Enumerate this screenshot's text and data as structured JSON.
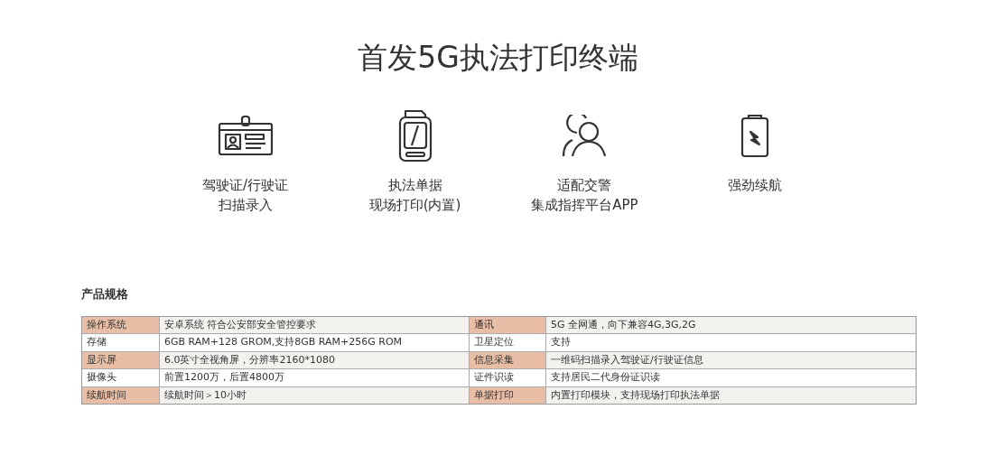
{
  "title": "首发5G执法打印终端",
  "features": [
    {
      "kind": "id-card",
      "lines": [
        "驾驶证/行驶证",
        "扫描录入"
      ]
    },
    {
      "kind": "printer",
      "lines": [
        "执法单据",
        "现场打印(内置)"
      ]
    },
    {
      "kind": "users",
      "lines": [
        "适配交警",
        "集成指挥平台APP"
      ]
    },
    {
      "kind": "battery",
      "lines": [
        "强劲续航"
      ]
    }
  ],
  "specs": {
    "heading": "产品规格",
    "rows": [
      {
        "shaded": true,
        "cells": [
          "操作系统",
          "安卓系统 符合公安部安全管控要求",
          "通讯",
          "5G 全网通，向下兼容4G,3G,2G"
        ]
      },
      {
        "shaded": false,
        "cells": [
          "存储",
          "6GB RAM+128 GROM,支持8GB RAM+256G ROM",
          "卫星定位",
          "支持"
        ]
      },
      {
        "shaded": true,
        "cells": [
          "显示屏",
          "6.0英寸全视角屏，分辨率2160*1080",
          "信息采集",
          "一维码扫描录入驾驶证/行驶证信息"
        ]
      },
      {
        "shaded": false,
        "cells": [
          "摄像头",
          "前置1200万，后置4800万",
          "证件识读",
          "支持居民二代身份证识读"
        ]
      },
      {
        "shaded": true,
        "cells": [
          "续航时间",
          "续航时间＞10小时",
          "单据打印",
          "内置打印模块，支持现场打印执法单据"
        ]
      }
    ]
  }
}
